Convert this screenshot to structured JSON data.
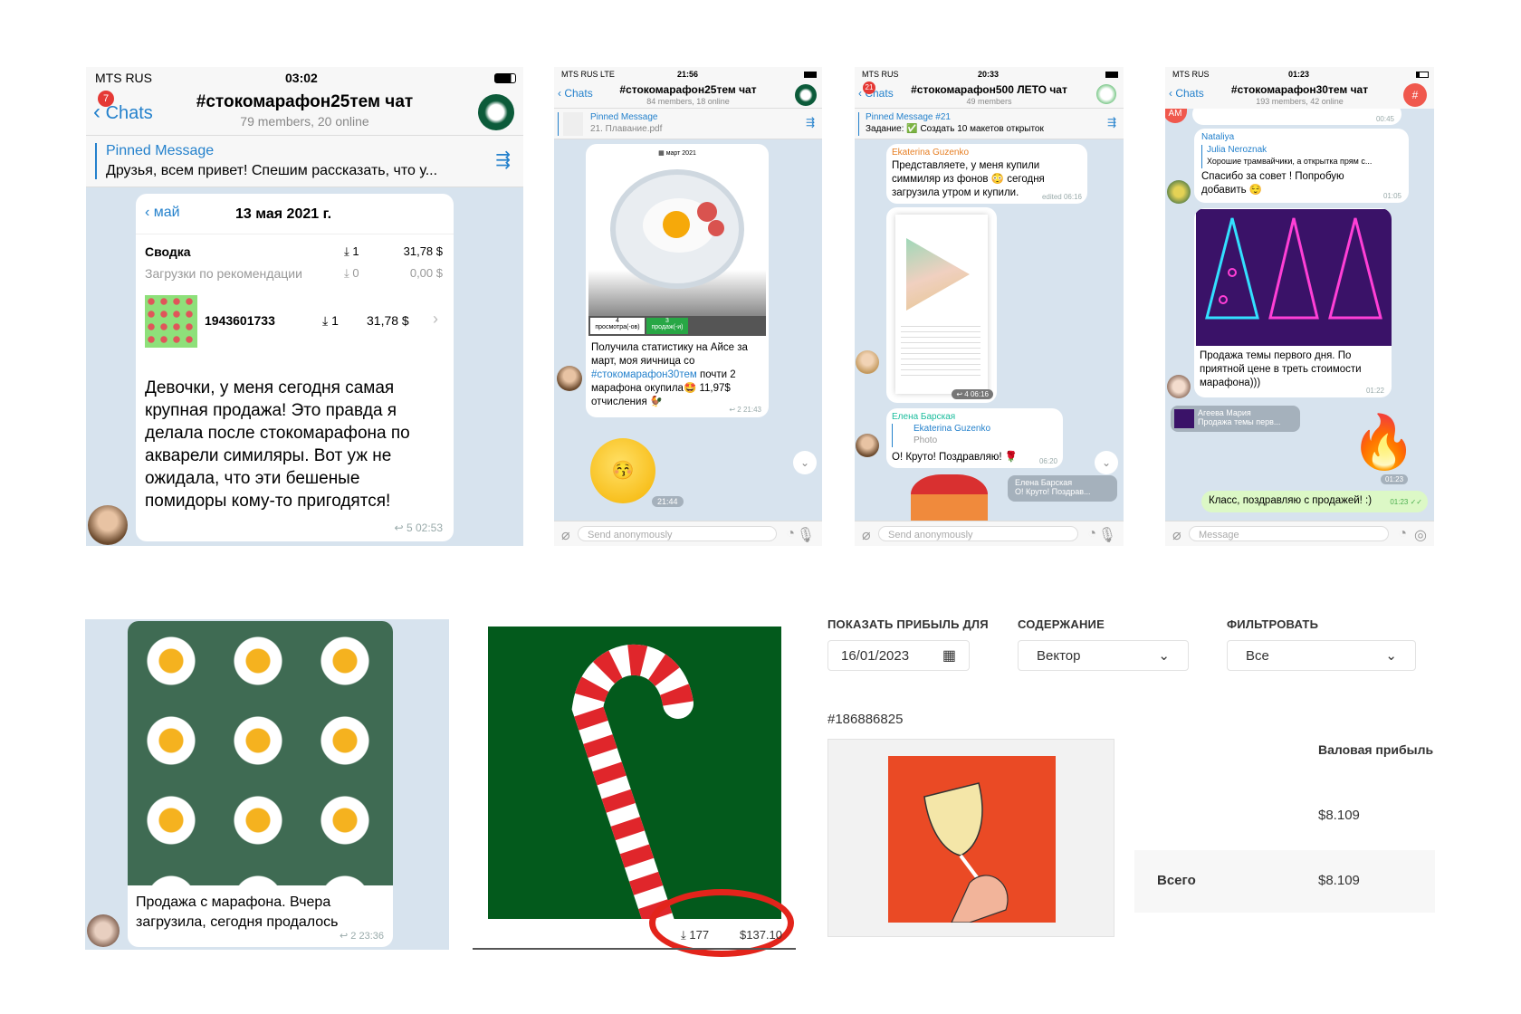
{
  "phone1": {
    "carrier": "MTS RUS",
    "time": "03:02",
    "back_label": "Chats",
    "unread_badge": "7",
    "title": "#стокомарафон25тем чат",
    "subtitle": "79 members, 20 online",
    "pinned_title": "Pinned Message",
    "pinned_text": "Друзья, всем привет! Спешим рассказать, что у...",
    "card": {
      "back_month": "май",
      "date": "13 мая 2021 г.",
      "summary_label": "Сводка",
      "summary_downloads": "1",
      "summary_amount": "31,78 $",
      "rec_label": "Загрузки по рекомендации",
      "rec_downloads": "0",
      "rec_amount": "0,00 $",
      "item_id": "1943601733",
      "item_downloads": "1",
      "item_amount": "31,78 $"
    },
    "message": "Девочки, у меня сегодня самая крупная продажа! Это правда я делала после стокомарафона по акварели симиляры. Вот уж не ожидала, что эти бешеные помидоры кому-то пригодятся!",
    "replies": "5",
    "msg_time": "02:53"
  },
  "phone2": {
    "carrier": "MTS RUS  LTE",
    "time": "21:56",
    "back_label": "Chats",
    "title": "#стокомарафон25тем чат",
    "subtitle": "84 members, 18 online",
    "pinned_title": "Pinned Message",
    "pinned_text": "21. Плавание.pdf",
    "card_month": "март 2021",
    "views": "4",
    "views_label": "просмотра(-ов)",
    "sales": "3",
    "sales_label": "продаж(-и)",
    "msg_part1": "Получила статистику на Айсе за март, моя яичница со ",
    "msg_hashtag": "#стокомарафон30тем",
    "msg_part2": " почти 2 марафона окупила🤩 11,97$ отчисления 🐓",
    "replies": "2",
    "msg_time": "21:43",
    "sticker_time": "21:44",
    "input_placeholder": "Send anonymously"
  },
  "phone3": {
    "carrier": "MTS RUS",
    "time": "20:33",
    "back_label": "Chats",
    "unread_badge": "21",
    "title": "#стокомарафон500 ЛЕТО чат",
    "subtitle": "49 members",
    "pinned_title": "Pinned Message #21",
    "pinned_text": "Задание: ✅ Создать 10 макетов открыток",
    "msg1_author": "Ekaterina Guzenko",
    "msg1_text": "Представляете, у меня купили симмиляр из фонов 😳 сегодня загрузила утром и купили.",
    "msg1_time": "edited 06:16",
    "photo_replies": "4",
    "photo_time": "06:16",
    "msg2_author": "Елена Барская",
    "msg2_reply_author": "Ekaterina Guzenko",
    "msg2_reply_text": "Photo",
    "msg2_text": "О! Круто! Поздравляю! 🌹",
    "msg2_time": "06:20",
    "reply_pill_author": "Елена Барская",
    "reply_pill_text": "О! Круто! Поздрав...",
    "input_placeholder": "Send anonymously"
  },
  "phone4": {
    "carrier": "MTS RUS",
    "time": "01:23",
    "back_label": "Chats",
    "title": "#стокомарафон30тем чат",
    "subtitle": "193 members, 42 online",
    "top_avatar": "AM",
    "top_time": "00:45",
    "msg1_author": "Nataliya",
    "msg1_reply_author": "Julia Neroznak",
    "msg1_reply_text": "Хорошие трамвайчики, а открытка прям с...",
    "msg1_text": "Спасибо за совет ! Попробую добавить 😌",
    "msg1_time": "01:05",
    "msg2_text": "Продажа темы первого дня. По приятной цене в треть стоимости марафона)))",
    "msg2_time": "01:22",
    "reply_author": "Агеева Мария",
    "reply_text": "Продажа темы перв...",
    "fire_time": "01:23",
    "own_text": "Класс, поздравляю с продажей! :)",
    "own_time": "01:23",
    "input_placeholder": "Message"
  },
  "eggs_chat": {
    "message": "Продажа с марафона. Вчера загрузила, сегодня продалось",
    "replies": "2",
    "msg_time": "23:36"
  },
  "candy": {
    "downloads": "177",
    "amount": "$137.10"
  },
  "profit": {
    "date_label": "ПОКАЗАТЬ ПРИБЫЛЬ ДЛЯ",
    "date_value": "16/01/2023",
    "content_label": "СОДЕРЖАНИЕ",
    "content_value": "Вектор",
    "filter_label": "ФИЛЬТРОВАТЬ",
    "filter_value": "Все",
    "item_id": "#186886825",
    "col_header": "Валовая прибыль",
    "item_profit": "$8.109",
    "total_label": "Всего",
    "total_profit": "$8.109"
  },
  "colors": {
    "telegram_blue": "#2481cc",
    "chat_bg": "#d7e3ee",
    "badge_red": "#e53935",
    "own_bubble": "#dcf8c6",
    "candy_green": "#035a1c",
    "art_orange": "#ea4a25"
  }
}
